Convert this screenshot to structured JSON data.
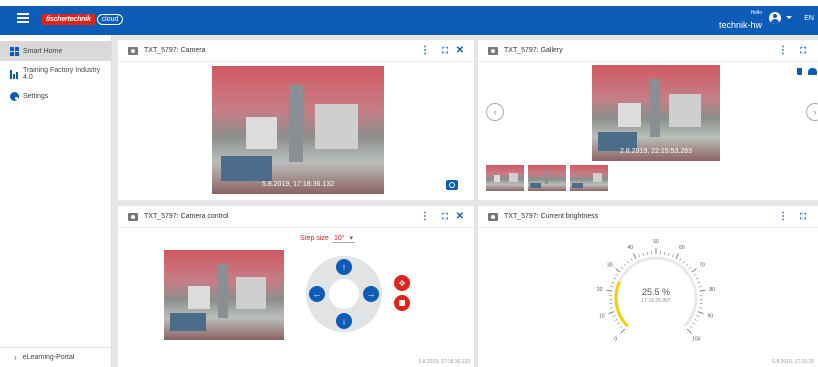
{
  "topbar": {
    "logo_text": "fischertechnik",
    "logo_cloud": "cloud",
    "hello": "Hello",
    "user": "technik-hw",
    "lang": "EN"
  },
  "sidebar": {
    "items": [
      {
        "label": "Smart Home",
        "icon": "dashboard-icon",
        "active": true
      },
      {
        "label": "Training Factory Industry 4.0",
        "icon": "factory-chart-icon",
        "active": false
      },
      {
        "label": "Settings",
        "icon": "gear-icon",
        "active": false
      }
    ],
    "bottom": {
      "label": "eLearning-Portal",
      "icon": "chevron-right-icon"
    }
  },
  "cards": {
    "camera": {
      "title": "TXT_5797: Camera",
      "timestamp": "5.8.2019, 17:18:36.132"
    },
    "gallery": {
      "title": "TXT_5797: Gallery",
      "timestamp": "2.8.2019, 22:15:53.263"
    },
    "camera_control": {
      "title": "TXT_5797: Camera control",
      "step_label": "Step size",
      "step_value": "10°",
      "footer_time": "5.8.2019, 17:18:36.132"
    },
    "brightness": {
      "title": "TXT_5797: Current brightness",
      "value": "25.5 %",
      "value_time": "17:16:25.997",
      "footer_time": "5.8.2019, 17:16:25",
      "gauge_ticks": [
        "0",
        "10",
        "20",
        "30",
        "40",
        "50",
        "60",
        "70",
        "80",
        "90",
        "100"
      ],
      "gauge_value_percent": 25.5,
      "gauge_color": "#f5d000"
    }
  },
  "colors": {
    "primary": "#0d5db8",
    "accent_red": "#e2231a"
  }
}
